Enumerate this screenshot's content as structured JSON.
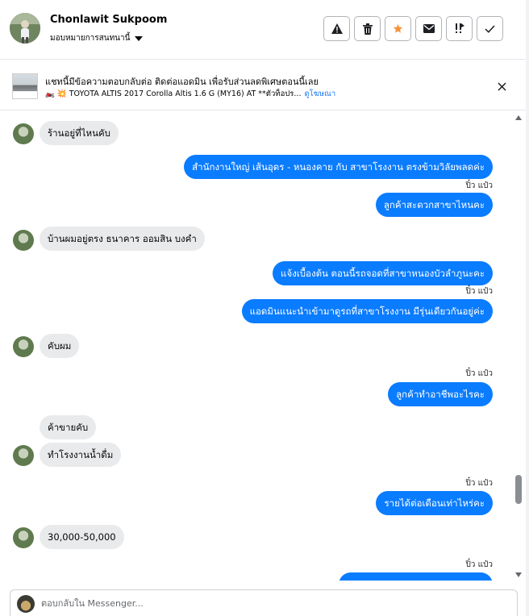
{
  "header": {
    "user_name": "Chonlawit Sukpoom",
    "assign_label": "มอบหมายการสนทนานี้",
    "actions": [
      {
        "icon": "warning-icon"
      },
      {
        "icon": "trash-icon"
      },
      {
        "icon": "star-icon",
        "color": "#f7923a"
      },
      {
        "icon": "envelope-icon"
      },
      {
        "icon": "follow-up-icon"
      },
      {
        "icon": "check-icon"
      }
    ]
  },
  "ad": {
    "title": "แชทนี้มีข้อความตอบกลับต่อ ติดต่อแอดมิน เพื่อรับส่วนลดพิเศษตอนนี้เลย",
    "subtitle": "🏍️ 💥 TOYOTA ALTIS 2017 Corolla Altis 1.6 G (MY16) AT **ตัวท็อปร...",
    "link": "ดูโฆษณา"
  },
  "messages": [
    {
      "dir": "in",
      "text": "ร้านอยู่ที่ไหนคับ"
    },
    {
      "dir": "out",
      "text": "สำนักงานใหญ่ เส้นอุดร - หนองคาย  กับ สาขาโรงงาน ตรงข้ามวิลัยพลดค่ะ"
    },
    {
      "dir": "out",
      "text": "ลูกค้าสะดวกสาขาไหนคะ",
      "seen": "ปิ๋ว แป๋ว"
    },
    {
      "dir": "in",
      "text": "บ้านผมอยู่ตรง ธนาคาร ออมสิน บงคำ"
    },
    {
      "dir": "out",
      "text": "แจ้งเบื้องต้น ตอนนี้รถจอดที่สาขาหนองบัวลำภูนะคะ"
    },
    {
      "dir": "out",
      "text": "แอดมินแนะนำเข้ามาดูรถที่สาขาโรงงาน มีรุ่นเดียวกันอยู่ค่ะ",
      "seen": "ปิ๋ว แป๋ว"
    },
    {
      "dir": "in",
      "text": "คับผม"
    },
    {
      "dir": "out",
      "text": "ลูกค้าทำอาชีพอะไรคะ",
      "seen": "ปิ๋ว แป๋ว"
    },
    {
      "dir": "in",
      "text": "ค้าขายคับ"
    },
    {
      "dir": "in",
      "text": "ทำโรงงานน้ำดื่ม"
    },
    {
      "dir": "out",
      "text": "รายได้ต่อเดือนเท่าไหร่คะ",
      "seen": "ปิ๋ว แป๋ว"
    },
    {
      "dir": "in",
      "text": "30,000-50,000"
    },
    {
      "dir": "out",
      "text": "",
      "seen": "ปิ๋ว แป๋ว"
    }
  ],
  "composer": {
    "placeholder": "ตอบกลับใน Messenger..."
  },
  "colors": {
    "outgoing_bubble": "#0a7cff",
    "incoming_bubble": "#e9eaec",
    "accent_star": "#f7923a"
  }
}
